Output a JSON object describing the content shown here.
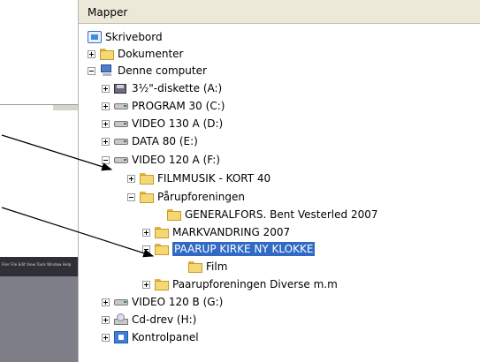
{
  "background": {
    "menubar_items": [
      "Filer",
      "File",
      "Edit",
      "View",
      "Tools",
      "Window",
      "Help"
    ]
  },
  "panel": {
    "title": "Mapper"
  },
  "tree": [
    {
      "label": "Skrivebord",
      "icon": "desktop-icon",
      "expander": "none"
    },
    {
      "label": "Dokumenter",
      "icon": "documents-folder-icon",
      "expander": "plus"
    },
    {
      "label": "Denne computer",
      "icon": "computer-icon",
      "expander": "minus"
    },
    {
      "label": "3½\"-diskette (A:)",
      "icon": "floppy-icon",
      "expander": "plus"
    },
    {
      "label": "PROGRAM 30 (C:)",
      "icon": "hard-drive-icon",
      "expander": "plus"
    },
    {
      "label": "VIDEO 130 A (D:)",
      "icon": "hard-drive-icon",
      "expander": "plus"
    },
    {
      "label": "DATA 80 (E:)",
      "icon": "hard-drive-icon",
      "expander": "plus"
    },
    {
      "label": "VIDEO 120 A (F:)",
      "icon": "hard-drive-icon",
      "expander": "minus"
    },
    {
      "label": "FILMMUSIK - KORT 40",
      "icon": "folder-icon",
      "expander": "plus"
    },
    {
      "label": "Pårupforeningen",
      "icon": "folder-icon",
      "expander": "minus"
    },
    {
      "label": "GENERALFORS. Bent Vesterled 2007",
      "icon": "folder-icon",
      "expander": "none"
    },
    {
      "label": "MARKVANDRING 2007",
      "icon": "folder-icon",
      "expander": "plus"
    },
    {
      "label": "PAARUP KIRKE NY KLOKKE",
      "icon": "folder-icon",
      "expander": "minus",
      "selected": true
    },
    {
      "label": "Film",
      "icon": "folder-icon",
      "expander": "none"
    },
    {
      "label": "Paarupforeningen Diverse m.m",
      "icon": "folder-icon",
      "expander": "plus"
    },
    {
      "label": "VIDEO 120 B (G:)",
      "icon": "hard-drive-icon",
      "expander": "plus"
    },
    {
      "label": "Cd-drev (H:)",
      "icon": "cd-drive-icon",
      "expander": "plus"
    },
    {
      "label": "Kontrolpanel",
      "icon": "control-panel-icon",
      "expander": "plus"
    }
  ],
  "colors": {
    "selection": "#316ac5",
    "header_bg": "#ece9d8",
    "arrow": "#000000"
  }
}
